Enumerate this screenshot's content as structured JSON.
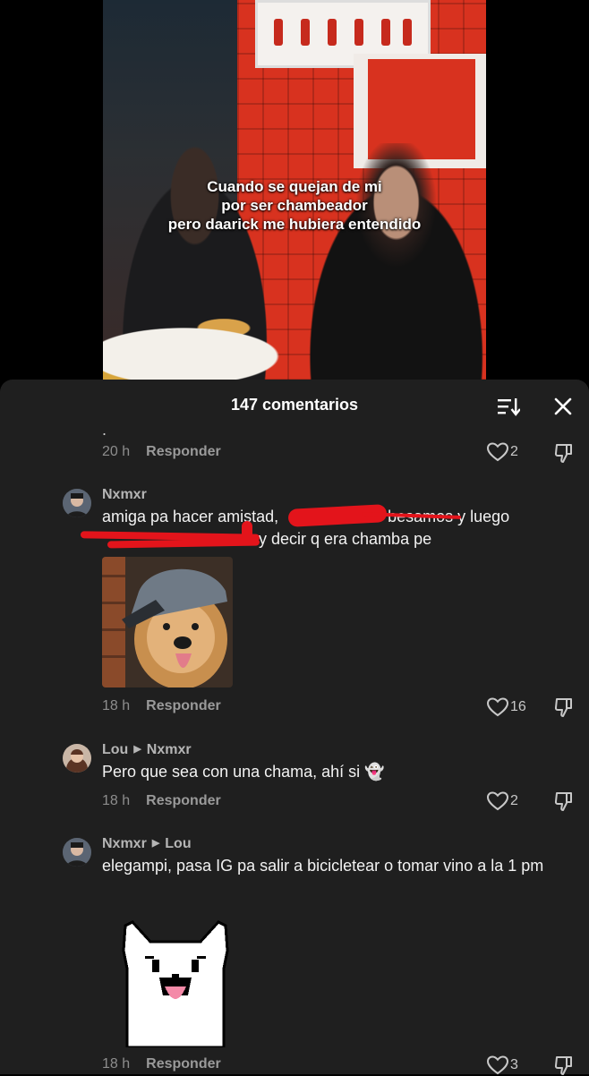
{
  "video": {
    "caption_lines": [
      "Cuando se quejan de mi",
      "por ser chambeador",
      "pero daarick me hubiera entendido"
    ]
  },
  "sheet": {
    "title": "147 comentarios"
  },
  "comments": [
    {
      "text": ".",
      "time": "20 h",
      "reply_label": "Responder",
      "likes": "2"
    },
    {
      "username": "Nxmxr",
      "text_line1": "amiga pa hacer amistad, ",
      "text_line1_end": " besamos y luego",
      "text_line2_end": " y decir q era chamba pe",
      "time": "18 h",
      "reply_label": "Responder",
      "likes": "16",
      "image_icon": "dog-with-cap-image"
    },
    {
      "username": "Lou",
      "reply_to": "Nxmxr",
      "text": "Pero que sea con una chama, ahí si 👻",
      "time": "18 h",
      "reply_label": "Responder",
      "likes": "2"
    },
    {
      "username": "Nxmxr",
      "reply_to": "Lou",
      "text": "elegampi, pasa IG pa salir a bicicletear o tomar vino a la 1 pm",
      "time": "18 h",
      "reply_label": "Responder",
      "likes": "3",
      "sticker_icon": "pixel-white-dog-sticker"
    }
  ],
  "colors": {
    "sheet_bg": "#1f1f1f",
    "scribble": "#e3141b",
    "meta_text": "#8d8d8d"
  }
}
